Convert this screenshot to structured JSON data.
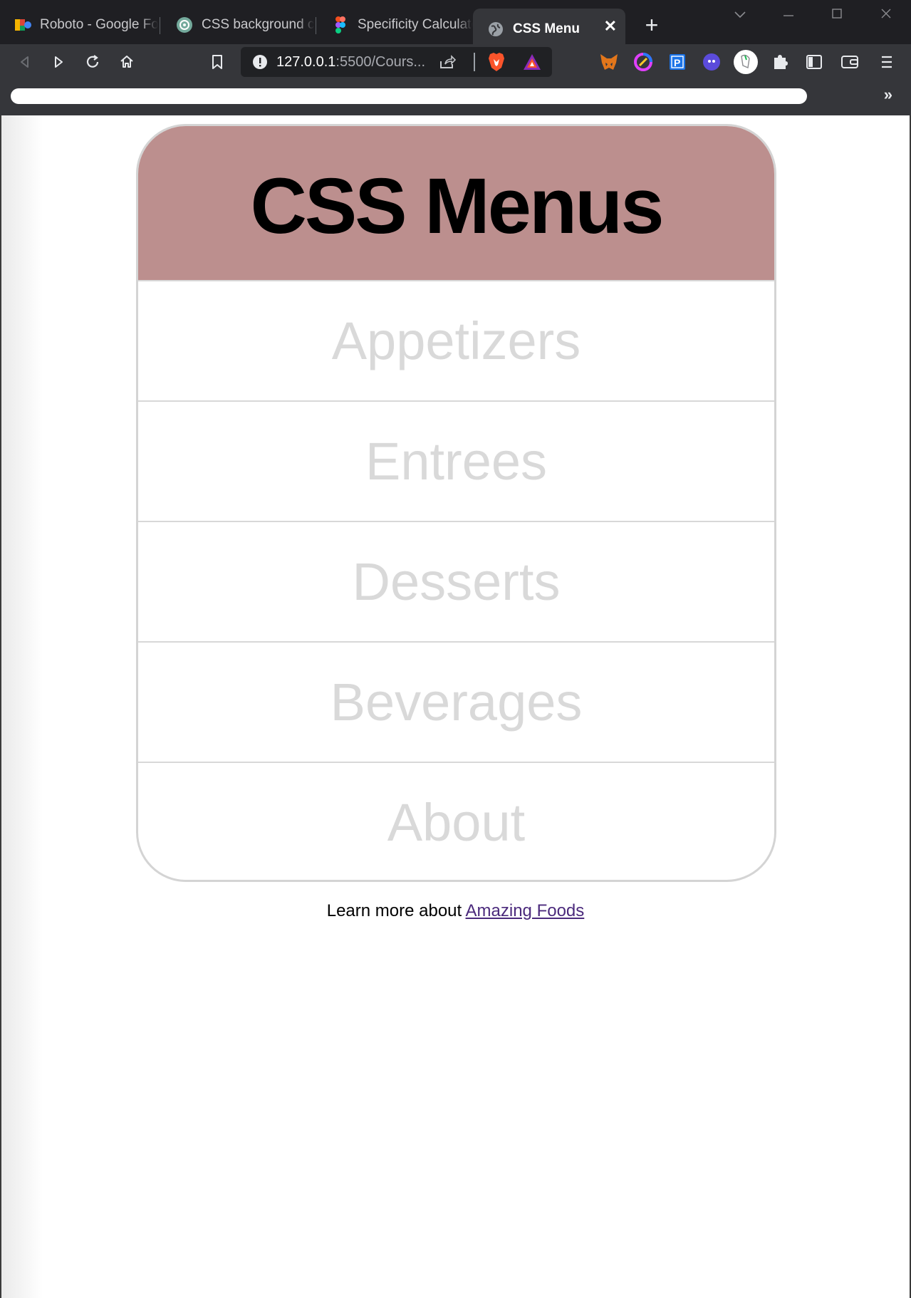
{
  "browser": {
    "tabs": [
      {
        "title": "Roboto - Google Fonts",
        "icon": "google-fonts-icon",
        "active": false
      },
      {
        "title": "CSS background color",
        "icon": "chatgpt-icon",
        "active": false
      },
      {
        "title": "Specificity Calculator",
        "icon": "figma-icon",
        "active": false
      },
      {
        "title": "CSS Menu",
        "icon": "globe-icon",
        "active": true
      }
    ],
    "close_glyph": "✕",
    "newtab_glyph": "+",
    "url_host": "127.0.0.1",
    "url_rest": ":5500/Cours...",
    "more_bookmarks_glyph": "»"
  },
  "page": {
    "header_title": "CSS Menus",
    "menu_items": [
      "Appetizers",
      "Entrees",
      "Desserts",
      "Beverages",
      "About"
    ],
    "footer_prefix": "Learn more about ",
    "footer_link": "Amazing Foods"
  },
  "colors": {
    "header_bg": "#bc8f8e",
    "menu_text": "#d9d9d9",
    "link": "#4b2a7c"
  }
}
